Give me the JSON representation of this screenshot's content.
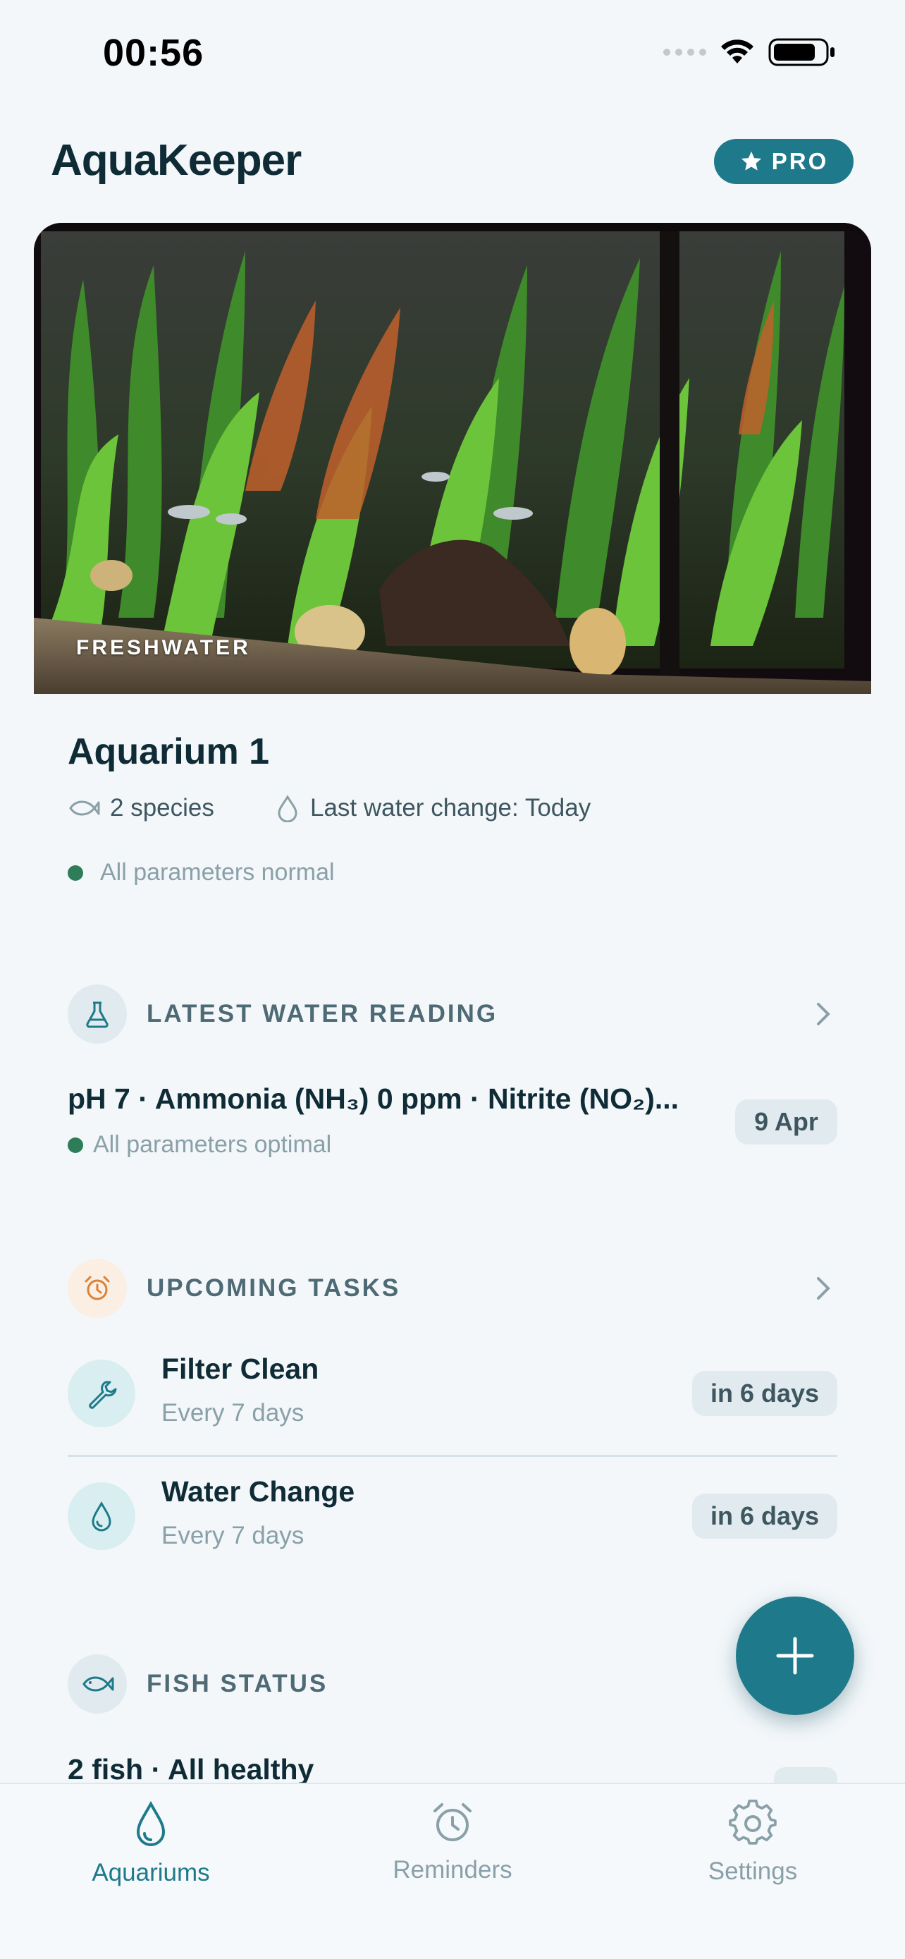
{
  "status_bar": {
    "time": "00:56"
  },
  "header": {
    "title": "AquaKeeper",
    "pro_label": "PRO"
  },
  "aquarium": {
    "type_tag": "FRESHWATER",
    "name": "Aquarium 1",
    "species": "2 species",
    "last_water_change": "Last water change: Today",
    "status": "All parameters normal"
  },
  "water_reading": {
    "title": "LATEST WATER READING",
    "summary": "pH 7 · Ammonia (NH₃) 0 ppm · Nitrite (NO₂)...",
    "status": "All parameters optimal",
    "date": "9 Apr"
  },
  "tasks": {
    "title": "UPCOMING TASKS",
    "items": [
      {
        "name": "Filter Clean",
        "frequency": "Every 7 days",
        "due": "in 6 days"
      },
      {
        "name": "Water Change",
        "frequency": "Every 7 days",
        "due": "in 6 days"
      }
    ]
  },
  "fish": {
    "title": "FISH STATUS",
    "summary": "2 fish · All healthy"
  },
  "tabbar": {
    "aquariums": "Aquariums",
    "reminders": "Reminders",
    "settings": "Settings"
  },
  "colors": {
    "accent": "#1e7a8a",
    "ok": "#2e7d58",
    "background": "#f3f7fa"
  }
}
